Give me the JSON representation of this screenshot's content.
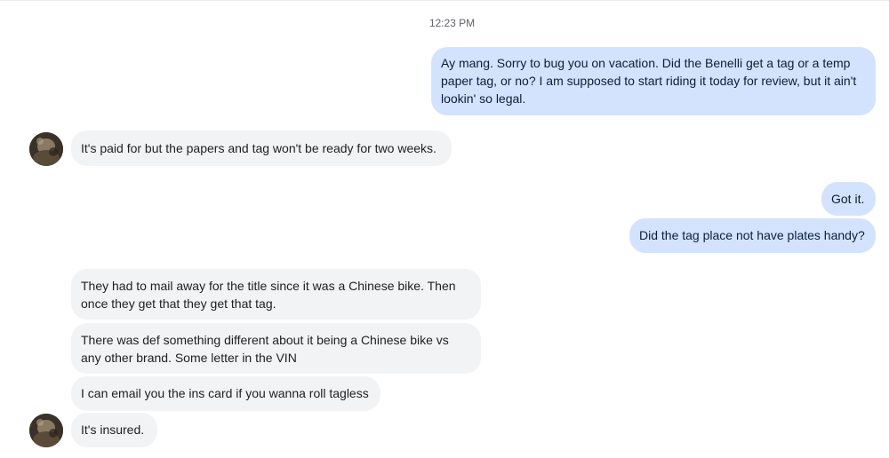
{
  "conversation": {
    "timestamp": "12:23 PM",
    "messages": [
      {
        "from": "me",
        "lines": [
          "Ay mang. Sorry to bug you on vacation. Did the Benelli get a tag or a temp",
          "paper tag, or no? I am supposed to start riding it today for review, but it ain't",
          "lookin' so legal."
        ]
      },
      {
        "from": "them",
        "lines": [
          "It's paid for but the papers and tag won't be ready for two weeks."
        ]
      },
      {
        "from": "me",
        "lines": [
          "Got it."
        ]
      },
      {
        "from": "me",
        "lines": [
          "Did the tag place not have plates handy?"
        ]
      },
      {
        "from": "them",
        "lines": [
          "They had to mail away for the title since it was a Chinese bike. Then",
          "once they get that they get that tag."
        ]
      },
      {
        "from": "them",
        "lines": [
          "There was def something different about it being a Chinese bike vs",
          "any other brand. Some letter in the VIN"
        ]
      },
      {
        "from": "them",
        "lines": [
          "I can email you the ins card if you wanna roll tagless"
        ]
      },
      {
        "from": "them",
        "lines": [
          "It's insured."
        ]
      }
    ]
  },
  "colors": {
    "outgoing_bubble": "#d3e3fd",
    "incoming_bubble": "#f1f3f4",
    "timestamp_text": "#5f6368"
  },
  "icons": {
    "avatar": "contact-avatar-photo"
  }
}
